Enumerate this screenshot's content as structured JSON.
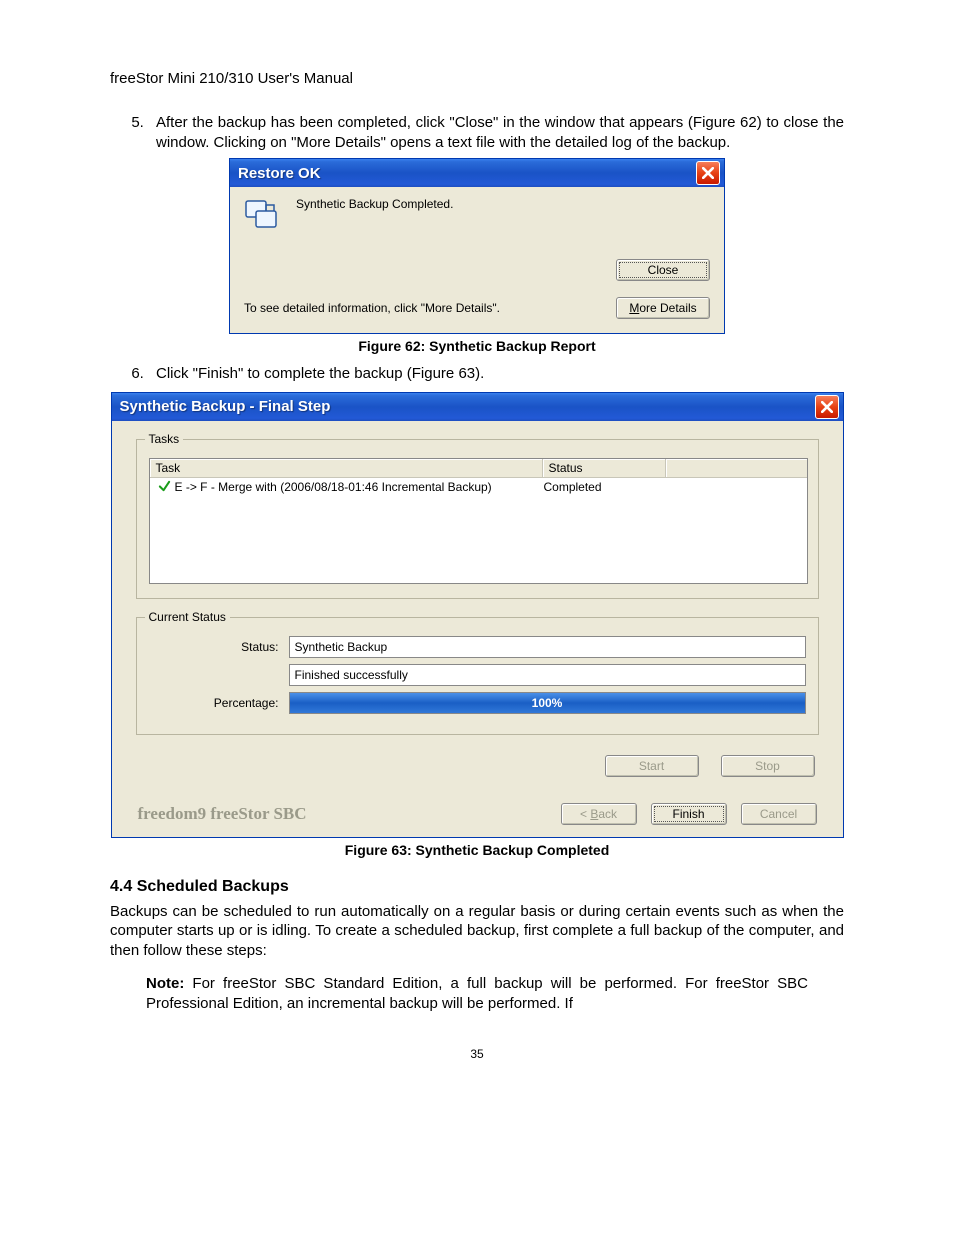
{
  "header": "freeStor Mini 210/310 User's Manual",
  "list": {
    "item5": "After the backup has been completed, click \"Close\" in the window that appears (Figure 62) to close the window.  Clicking on \"More Details\" opens a text file with the detailed log of the backup.",
    "item6": "Click \"Finish\" to complete the backup (Figure 63)."
  },
  "restore_dialog": {
    "title": "Restore OK",
    "message": "Synthetic Backup Completed.",
    "info_text": "To see detailed information, click \"More Details\".",
    "close_btn": "Close",
    "more_details_btn": "More Details"
  },
  "caption62": "Figure 62: Synthetic Backup Report",
  "synth_dialog": {
    "title": "Synthetic Backup - Final Step",
    "tasks_legend": "Tasks",
    "task_header": {
      "col1": "Task",
      "col2": "Status"
    },
    "task_row": {
      "name": "E -> F - Merge with (2006/08/18-01:46 Incremental Backup)",
      "status": "Completed"
    },
    "current_status_legend": "Current Status",
    "status_label": "Status:",
    "status_value": "Synthetic Backup",
    "status_value2": "Finished successfully",
    "percentage_label": "Percentage:",
    "percentage_value": "100%",
    "start_btn": "Start",
    "stop_btn": "Stop",
    "brand": "freedom9 freeStor SBC",
    "back_btn": "< Back",
    "finish_btn": "Finish",
    "cancel_btn": "Cancel"
  },
  "caption63": "Figure 63: Synthetic Backup Completed",
  "section": {
    "heading": "4.4   Scheduled Backups",
    "para": "Backups can be scheduled to run automatically on a regular basis or during certain events such as when the computer starts up or is idling.  To create a scheduled backup, first complete a full backup of the computer, and then follow these steps:",
    "note_label": "Note:",
    "note_body": " For freeStor SBC Standard Edition, a full backup will be performed.  For freeStor SBC Professional Edition, an incremental backup will be performed.  If"
  },
  "page_number": "35"
}
